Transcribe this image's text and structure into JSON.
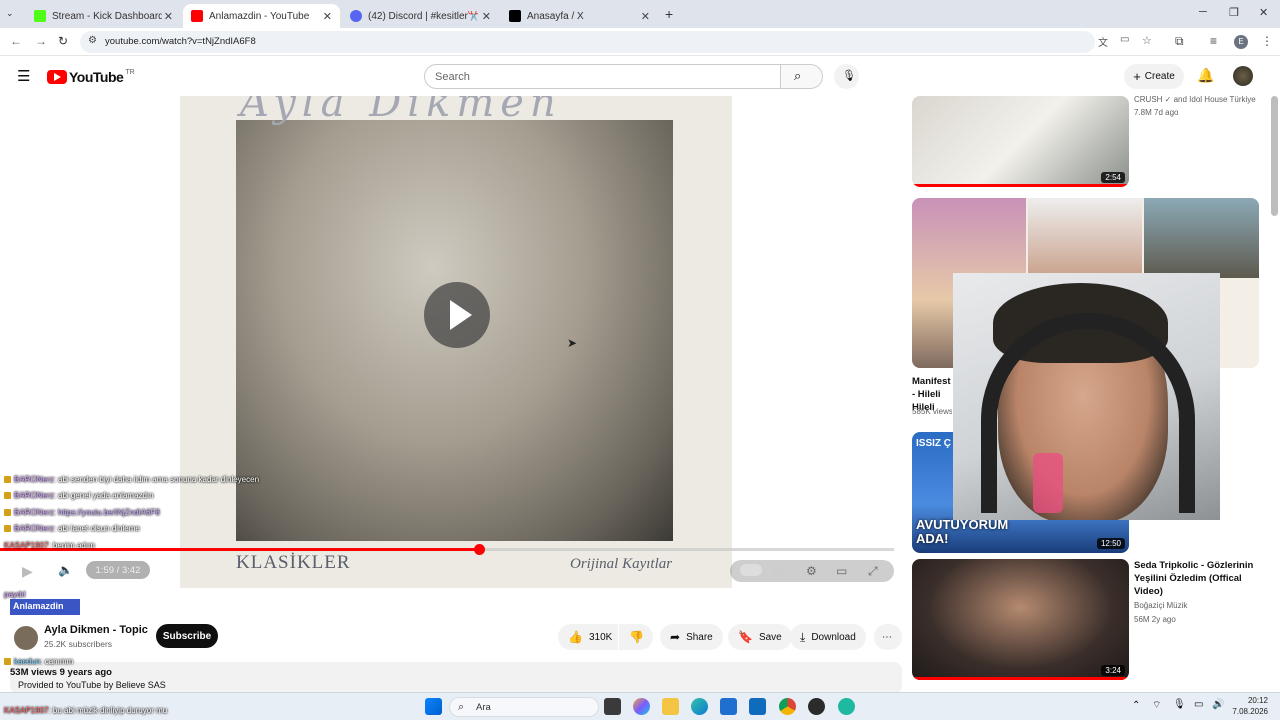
{
  "browser": {
    "tabs": [
      {
        "title": "Stream - Kick Dashboard",
        "active": false,
        "favicon_color": "#53fc18"
      },
      {
        "title": "Anlamazdin - YouTube",
        "active": true,
        "favicon_color": "#ff0000"
      },
      {
        "title": "(42) Discord | #kesitler✂️ | PE'Y",
        "active": false,
        "favicon_color": "#5865f2"
      },
      {
        "title": "Anasayfa / X",
        "active": false,
        "favicon_color": "#000000"
      }
    ],
    "url": "youtube.com/watch?v=tNjZndIA6F8",
    "profile_initial": "E"
  },
  "youtube": {
    "logo_text": "YouTube",
    "logo_region": "TR",
    "search_placeholder": "Search",
    "create_label": "Create"
  },
  "video": {
    "album_artist_script": "Ayla Dikmen",
    "album_label_left": "KLASİKLER",
    "album_label_right": "Orijinal Kayıtlar",
    "time": "1:59 / 3:42",
    "progress_fraction": 0.536,
    "channel_name": "Ayla Dikmen - Topic",
    "subscribers": "25.2K subscribers",
    "subscribe_label": "Subscribe",
    "likes": "310K",
    "share_label": "Share",
    "save_label": "Save",
    "download_label": "Download",
    "views_date": "53M views  9 years ago",
    "provided": "Provided to YouTube by Believe SAS"
  },
  "chat_overlay": {
    "lines": [
      {
        "user": "BARONerz",
        "text": ": abi senden biyi daha iidim ama sonuna kadar dinleyecen"
      },
      {
        "user": "BARONerz",
        "text": ": abi genel yada anlamazdın"
      },
      {
        "user": "BARONerz",
        "text": ": https://youtu.be/tNjZndIA6F8"
      },
      {
        "user": "BARONerz",
        "text": ": abi lanet olsun dinleme"
      },
      {
        "user": "KASAP1907",
        "text": ": benim adım"
      },
      {
        "user": "paydıl",
        "text": ""
      },
      {
        "user": "kaedun",
        "text": ": canımm"
      },
      {
        "user": "KASAP1907",
        "text": ": bu abi müzik dinliyip duruyor mu"
      }
    ],
    "highlight": "Anlamazdin"
  },
  "recommendations": [
    {
      "title": "",
      "meta1": "CRUSH ✓ and Idol House Türkiye",
      "meta2": "7.8M  7d ago",
      "duration": "2:54",
      "thumb_colors": [
        "#d9d6cf",
        "#f3f1ec",
        "#8a8f8a"
      ]
    },
    {
      "title": "Manifest - Hileli Hileli",
      "meta1": "585K views",
      "meta2": "",
      "duration": "",
      "thumb_colors": [
        "#c892b8",
        "#e7c9a8",
        "#7f6a5e"
      ]
    },
    {
      "title": "",
      "meta1": "",
      "meta2": "",
      "duration": "12:50",
      "thumb_colors": [
        "#2b6cc4",
        "#ffffff",
        "#1a3d7a"
      ],
      "thumb_text_top": "ISSIZ Ç",
      "thumb_text_bottom": "AVUTUYORUM ADA!"
    },
    {
      "title": "Seda Tripkolic - Gözlerinin Yeşilini Özledim (Offical Video)",
      "meta1": "Boğaziçi Müzik",
      "meta2": "56M  2y ago",
      "duration": "3:24",
      "thumb_colors": [
        "#3a2e2a",
        "#b58a70",
        "#1e1a18"
      ]
    }
  ],
  "taskbar": {
    "search_placeholder": "Ara",
    "time": "20:12",
    "date": "7.08.2026"
  }
}
